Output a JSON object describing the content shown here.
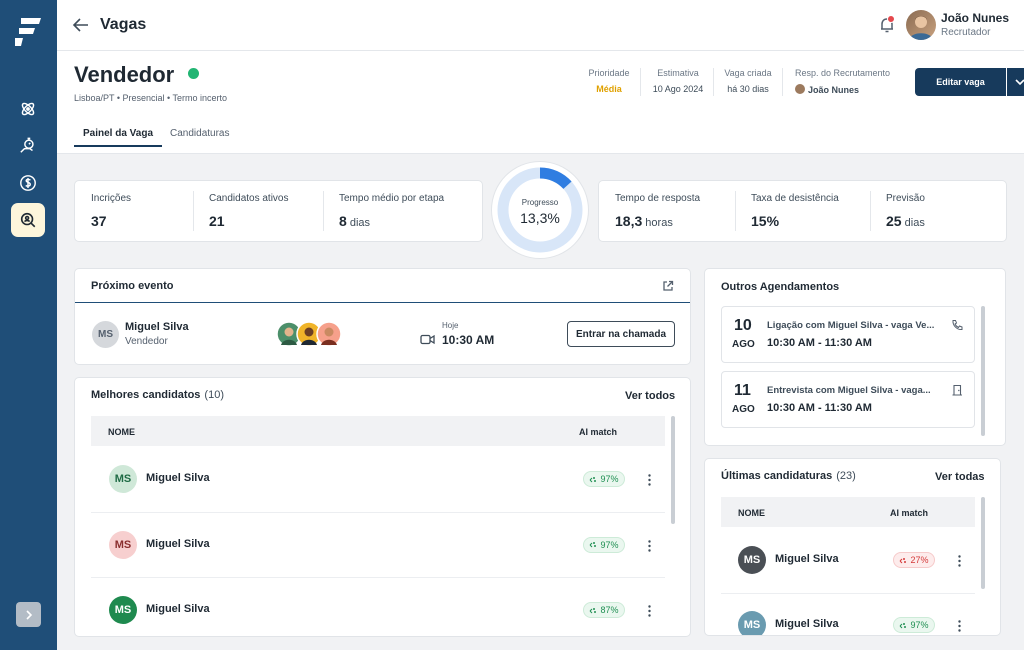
{
  "header": {
    "title": "Vagas",
    "user": {
      "name": "João Nunes",
      "role": "Recrutador"
    }
  },
  "job": {
    "title": "Vendedor",
    "meta": "Lisboa/PT  •  Presencial  •  Termo incerto",
    "priority": {
      "label": "Prioridade",
      "value": "Média"
    },
    "estimate": {
      "label": "Estimativa",
      "value": "10 Ago 2024"
    },
    "created": {
      "label": "Vaga criada",
      "value": "há 30 dias"
    },
    "owner": {
      "label": "Resp. do Recrutamento",
      "value": "João Nunes"
    },
    "edit_label": "Editar vaga"
  },
  "tabs": [
    "Painel da Vaga",
    "Candidaturas"
  ],
  "stats_left": [
    {
      "label": "Incrições",
      "value": "37",
      "unit": ""
    },
    {
      "label": "Candidatos ativos",
      "value": "21",
      "unit": ""
    },
    {
      "label": "Tempo médio por etapa",
      "value": "8",
      "unit": " dias"
    }
  ],
  "progress": {
    "label": "Progresso",
    "value": "13,3%",
    "fraction": 0.133
  },
  "stats_right": [
    {
      "label": "Tempo de resposta",
      "value": "18,3",
      "unit": " horas"
    },
    {
      "label": "Taxa de desistência",
      "value": "15%",
      "unit": ""
    },
    {
      "label": "Previsão",
      "value": "25",
      "unit": " dias"
    }
  ],
  "next_event": {
    "title": "Próximo evento",
    "initials": "MS",
    "name": "Miguel Silva",
    "role": "Vendedor",
    "day_label": "Hoje",
    "time": "10:30 AM",
    "button": "Entrar na chamada"
  },
  "best_candidates": {
    "title": "Melhores candidatos",
    "count": "(10)",
    "link": "Ver todos",
    "columns": [
      "NOME",
      "AI match"
    ],
    "rows": [
      {
        "initials": "MS",
        "name": "Miguel Silva",
        "match": "97%",
        "avatar_bg": "#cfe8d8",
        "avatar_fg": "#1f6b45",
        "good": true
      },
      {
        "initials": "MS",
        "name": "Miguel Silva",
        "match": "97%",
        "avatar_bg": "#f7cfcf",
        "avatar_fg": "#8a2f2f",
        "good": true
      },
      {
        "initials": "MS",
        "name": "Miguel Silva",
        "match": "87%",
        "avatar_bg": "#1f8a4f",
        "avatar_fg": "#ffffff",
        "good": true
      }
    ]
  },
  "other_schedules": {
    "title": "Outros Agendamentos",
    "events": [
      {
        "day": "10",
        "month": "AGO",
        "text": "Ligação com Miguel Silva - vaga Ve...",
        "time": "10:30 AM - 11:30 AM",
        "icon": "phone-icon"
      },
      {
        "day": "11",
        "month": "AGO",
        "text": "Entrevista com Miguel Silva - vaga...",
        "time": "10:30 AM - 11:30 AM",
        "icon": "door-icon"
      }
    ]
  },
  "latest_applications": {
    "title": "Últimas candidaturas",
    "count": "(23)",
    "link": "Ver todas",
    "columns": [
      "NOME",
      "AI match"
    ],
    "rows": [
      {
        "initials": "MS",
        "name": "Miguel Silva",
        "match": "27%",
        "avatar_bg": "#4a4f55",
        "avatar_fg": "#ffffff",
        "good": false
      },
      {
        "initials": "MS",
        "name": "Miguel Silva",
        "match": "97%",
        "avatar_bg": "#6a9bb0",
        "avatar_fg": "#ffffff",
        "good": true
      }
    ]
  },
  "colors": {
    "sidebar": "#1f4e78",
    "primary": "#173a5c",
    "accent": "#2f7de1",
    "success": "#22b573",
    "warning": "#e0a100"
  }
}
